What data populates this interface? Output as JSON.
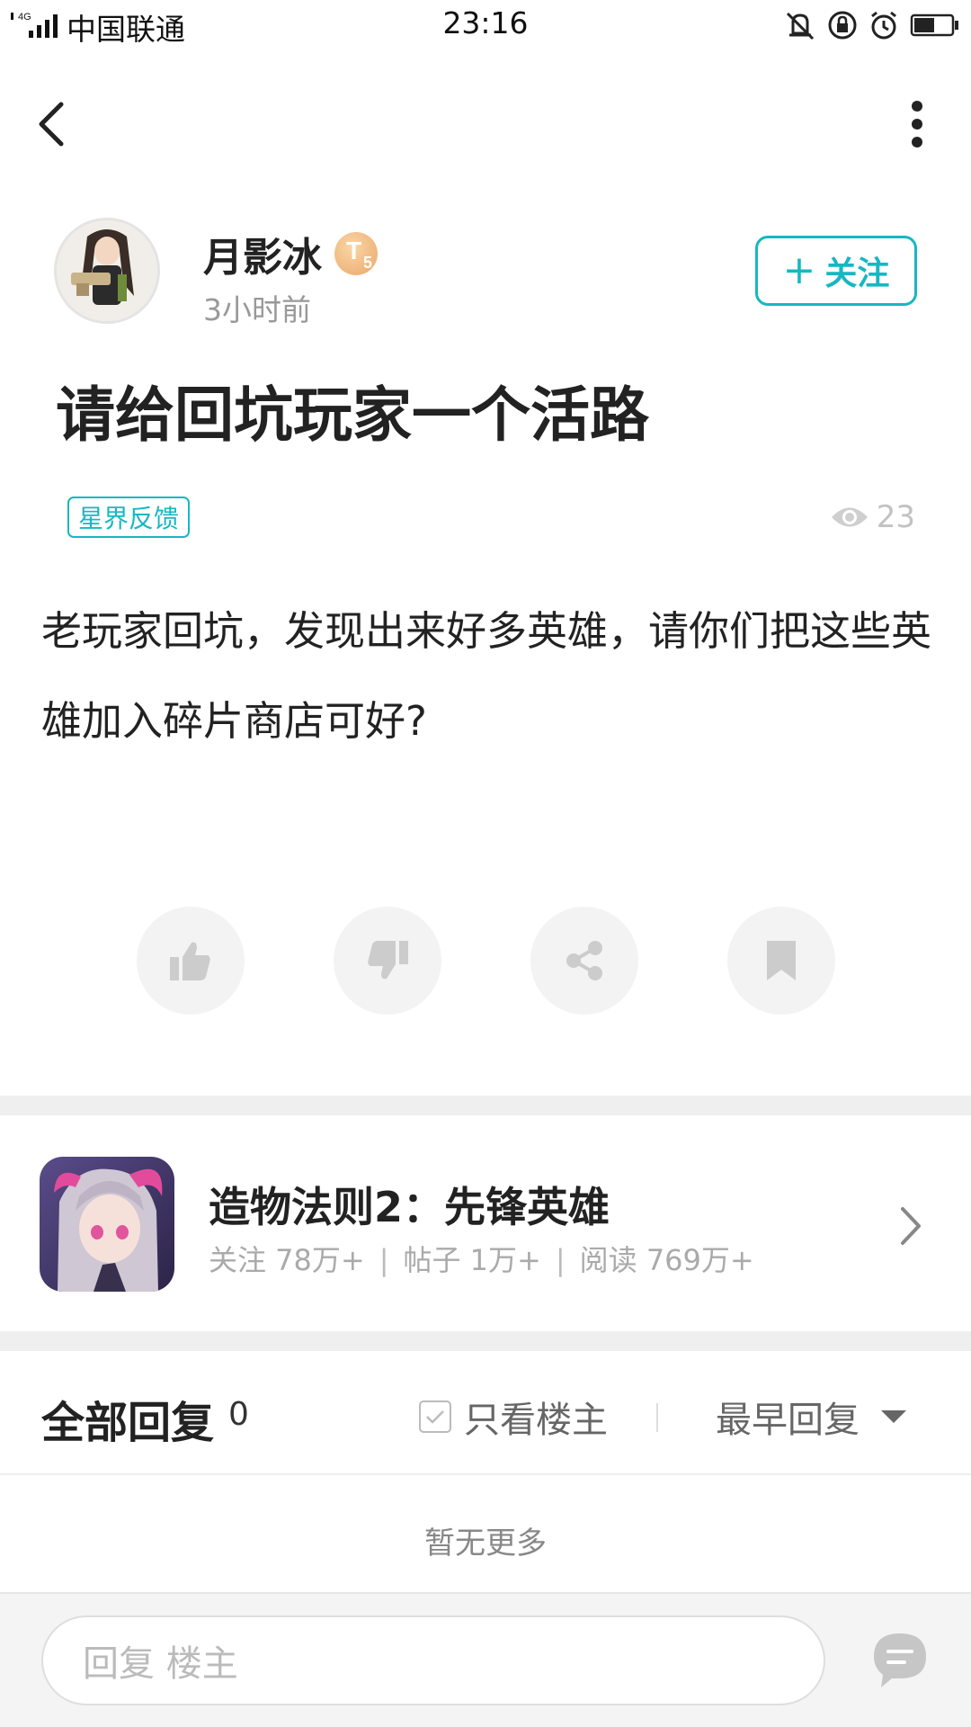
{
  "status_bar": {
    "network": "4G",
    "carrier": "中国联通",
    "time": "23:16",
    "icons": [
      "vibrate-icon",
      "rotation-lock-icon",
      "alarm-icon",
      "battery-icon"
    ],
    "battery_level": 0.55
  },
  "nav": {
    "back_icon": "chevron-left-icon",
    "more_icon": "more-vertical-icon"
  },
  "author": {
    "name": "月影冰",
    "level_letter": "T",
    "level_number": "5",
    "time_ago": "3小时前",
    "follow_label": "关注",
    "follow_plus": "+"
  },
  "post": {
    "title": "请给回坑玩家一个活路",
    "tag": "星界反馈",
    "views": "23",
    "content": "老玩家回坑，发现出来好多英雄，请你们把这些英雄加入碎片商店可好?"
  },
  "actions": [
    {
      "name": "like",
      "icon": "thumbs-up-icon"
    },
    {
      "name": "dislike",
      "icon": "thumbs-down-icon"
    },
    {
      "name": "share",
      "icon": "share-icon"
    },
    {
      "name": "bookmark",
      "icon": "bookmark-icon"
    }
  ],
  "game": {
    "name": "造物法则2：先锋英雄",
    "stats": {
      "follow": "关注 78万+",
      "posts": "帖子 1万+",
      "reads": "阅读 769万+"
    },
    "separator": "|"
  },
  "replies": {
    "title": "全部回复",
    "count": "0",
    "op_only": "只看楼主",
    "sort": "最早回复",
    "no_more": "暂无更多"
  },
  "reply_bar": {
    "placeholder": "回复  楼主"
  },
  "colors": {
    "accent": "#17b7c2",
    "muted": "#999999",
    "divider": "#efefef"
  }
}
